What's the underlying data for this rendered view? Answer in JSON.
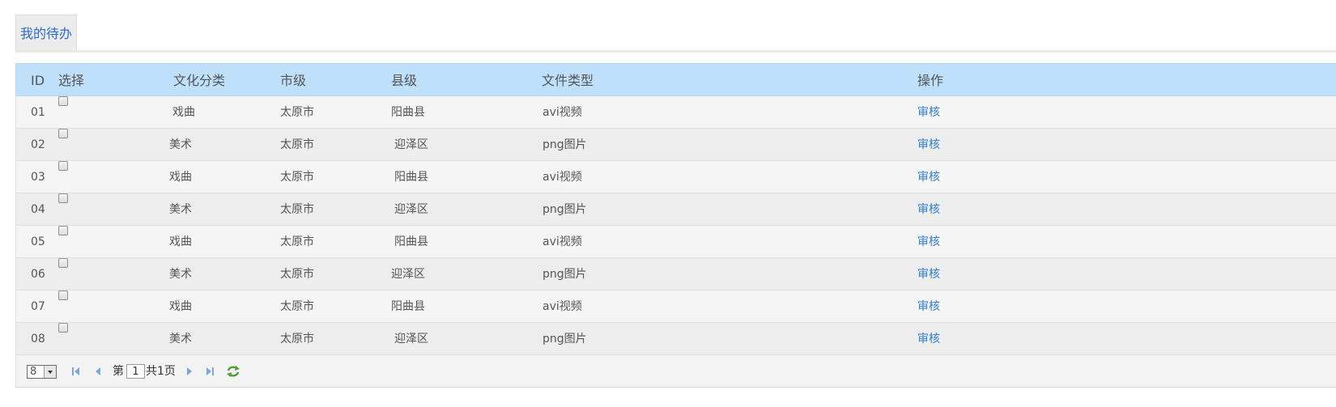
{
  "tabs": [
    {
      "label": "我的待办"
    }
  ],
  "table": {
    "headers": {
      "id": "ID",
      "select": "选择",
      "category": "文化分类",
      "city": "市级",
      "county": "县级",
      "filetype": "文件类型",
      "action": "操作"
    },
    "rows": [
      {
        "id": "01",
        "category": "戏曲",
        "city": "太原市",
        "county": "阳曲县",
        "filetype": "avi视频",
        "action": "审核"
      },
      {
        "id": "02",
        "category": "美术",
        "city": "太原市",
        "county": "迎泽区",
        "filetype": "png图片",
        "action": "审核"
      },
      {
        "id": "03",
        "category": "戏曲",
        "city": "太原市",
        "county": "阳曲县",
        "filetype": "avi视频",
        "action": "审核"
      },
      {
        "id": "04",
        "category": "美术",
        "city": "太原市",
        "county": "迎泽区",
        "filetype": "png图片",
        "action": "审核"
      },
      {
        "id": "05",
        "category": "戏曲",
        "city": "太原市",
        "county": "阳曲县",
        "filetype": "avi视频",
        "action": "审核"
      },
      {
        "id": "06",
        "category": "美术",
        "city": "太原市",
        "county": "迎泽区",
        "filetype": "png图片",
        "action": "审核"
      },
      {
        "id": "07",
        "category": "戏曲",
        "city": "太原市",
        "county": "阳曲县",
        "filetype": "avi视频",
        "action": "审核"
      },
      {
        "id": "08",
        "category": "美术",
        "city": "太原市",
        "county": "迎泽区",
        "filetype": "png图片",
        "action": "审核"
      }
    ]
  },
  "pager": {
    "page_size": "8",
    "page_prefix": "第",
    "current_page": "1",
    "total_text": "共1页",
    "icons": [
      "first-page-icon",
      "prev-page-icon",
      "next-page-icon",
      "last-page-icon",
      "refresh-icon"
    ]
  },
  "colors": {
    "header_bg": "#bfe0fb",
    "link": "#2f7fcf",
    "tab_text": "#2a6ccb"
  }
}
